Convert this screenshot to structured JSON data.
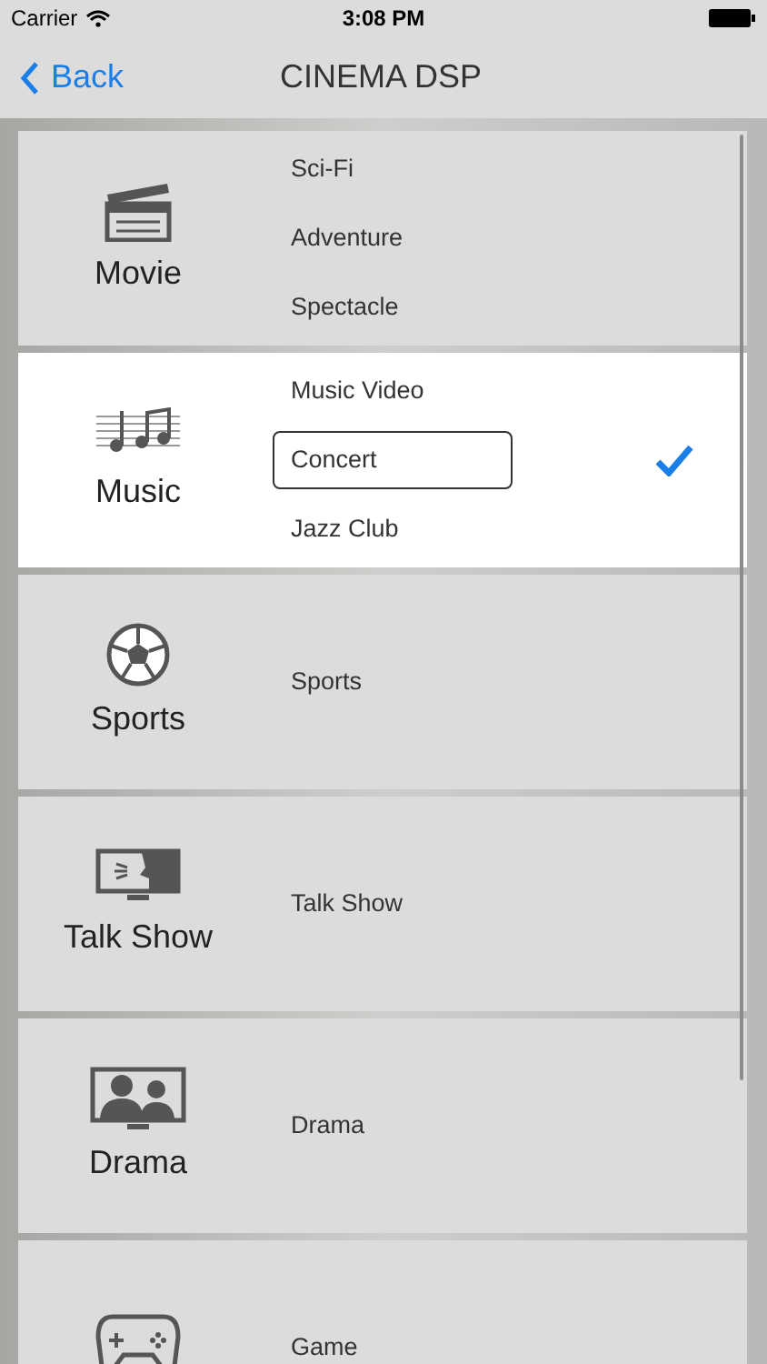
{
  "status_bar": {
    "carrier": "Carrier",
    "time": "3:08 PM"
  },
  "nav": {
    "back": "Back",
    "title": "CINEMA DSP"
  },
  "categories": [
    {
      "kind": "movie",
      "label": "Movie",
      "selected": false,
      "options": [
        {
          "label": "Sci-Fi",
          "selected": false
        },
        {
          "label": "Adventure",
          "selected": false
        },
        {
          "label": "Spectacle",
          "selected": false
        }
      ]
    },
    {
      "kind": "music",
      "label": "Music",
      "selected": true,
      "options": [
        {
          "label": "Music Video",
          "selected": false
        },
        {
          "label": "Concert",
          "selected": true
        },
        {
          "label": "Jazz Club",
          "selected": false
        }
      ]
    },
    {
      "kind": "sports",
      "label": "Sports",
      "selected": false,
      "options": [
        {
          "label": "Sports",
          "selected": false
        }
      ]
    },
    {
      "kind": "talk",
      "label": "Talk Show",
      "selected": false,
      "options": [
        {
          "label": "Talk Show",
          "selected": false
        }
      ]
    },
    {
      "kind": "drama",
      "label": "Drama",
      "selected": false,
      "options": [
        {
          "label": "Drama",
          "selected": false
        }
      ]
    },
    {
      "kind": "game",
      "options": [
        {
          "label": "Game",
          "selected": false
        }
      ],
      "selected": false
    }
  ]
}
